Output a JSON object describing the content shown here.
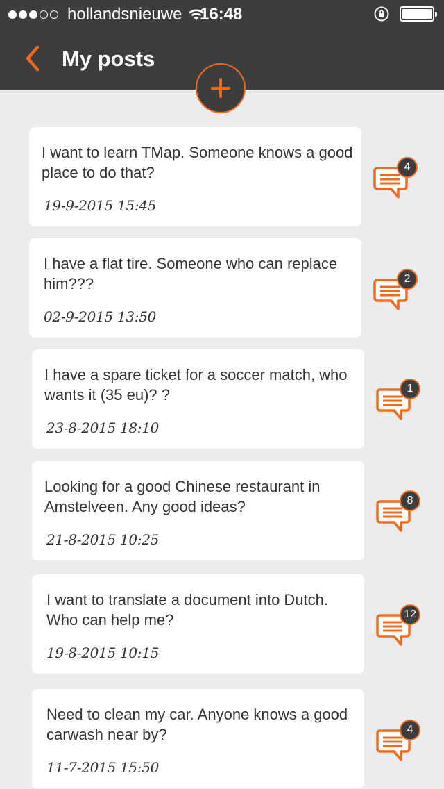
{
  "statusbar": {
    "carrier": "hollandsnieuwe",
    "time": "16:48"
  },
  "header": {
    "title": "My posts"
  },
  "colors": {
    "accent": "#ee6a1e",
    "header_bg": "#3d3d3d",
    "page_bg": "#ececec"
  },
  "icons": {
    "back": "chevron-left-icon",
    "add": "plus-icon",
    "comment": "speech-bubble-icon"
  },
  "posts": [
    {
      "text": "I want to learn TMap. Someone knows a good place to do that?",
      "date": "19-9-2015  15:45",
      "comments": "4"
    },
    {
      "text": "I have a flat tire. Someone who can replace him???",
      "date": "02-9-2015  13:50",
      "comments": "2"
    },
    {
      "text": "I have a spare ticket for a soccer match, who wants it (35 eu)? ?",
      "date": "23-8-2015  18:10",
      "comments": "1"
    },
    {
      "text": "Looking for a good Chinese restaurant in Amstelveen. Any good ideas?",
      "date": "21-8-2015  10:25",
      "comments": "8"
    },
    {
      "text": "I want to translate a document into Dutch. Who can help me?",
      "date": "19-8-2015  10:15",
      "comments": "12"
    },
    {
      "text": "Need to clean my car. Anyone knows a good carwash near by?",
      "date": "11-7-2015  15:50",
      "comments": "4"
    }
  ]
}
